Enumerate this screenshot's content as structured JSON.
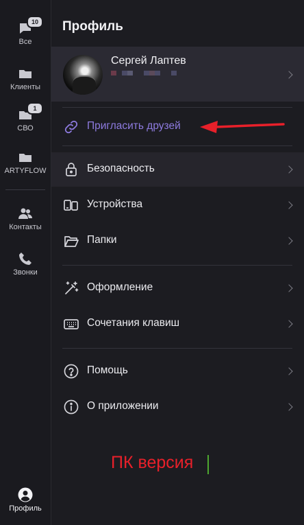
{
  "rail": {
    "items": [
      {
        "label": "Все",
        "badge": "10"
      },
      {
        "label": "Клиенты",
        "badge": ""
      },
      {
        "label": "СВО",
        "badge": "1"
      },
      {
        "label": "ARTYFLOW",
        "badge": ""
      },
      {
        "label": "Контакты",
        "badge": ""
      },
      {
        "label": "Звонки",
        "badge": ""
      },
      {
        "label": "Профиль",
        "badge": ""
      }
    ]
  },
  "header": {
    "title": "Профиль"
  },
  "profile": {
    "name": "Сергей Лаптев"
  },
  "menu": {
    "invite": "Пригласить друзей",
    "security": "Безопасность",
    "devices": "Устройства",
    "folders": "Папки",
    "appearance": "Оформление",
    "shortcuts": "Сочетания клавиш",
    "help": "Помощь",
    "about": "О приложении"
  },
  "annotation": {
    "text": "ПК версия",
    "arrow_color": "#e8202a"
  },
  "colors": {
    "accent": "#8e7be0",
    "background": "#1c1c21",
    "card": "#2b2a33"
  }
}
